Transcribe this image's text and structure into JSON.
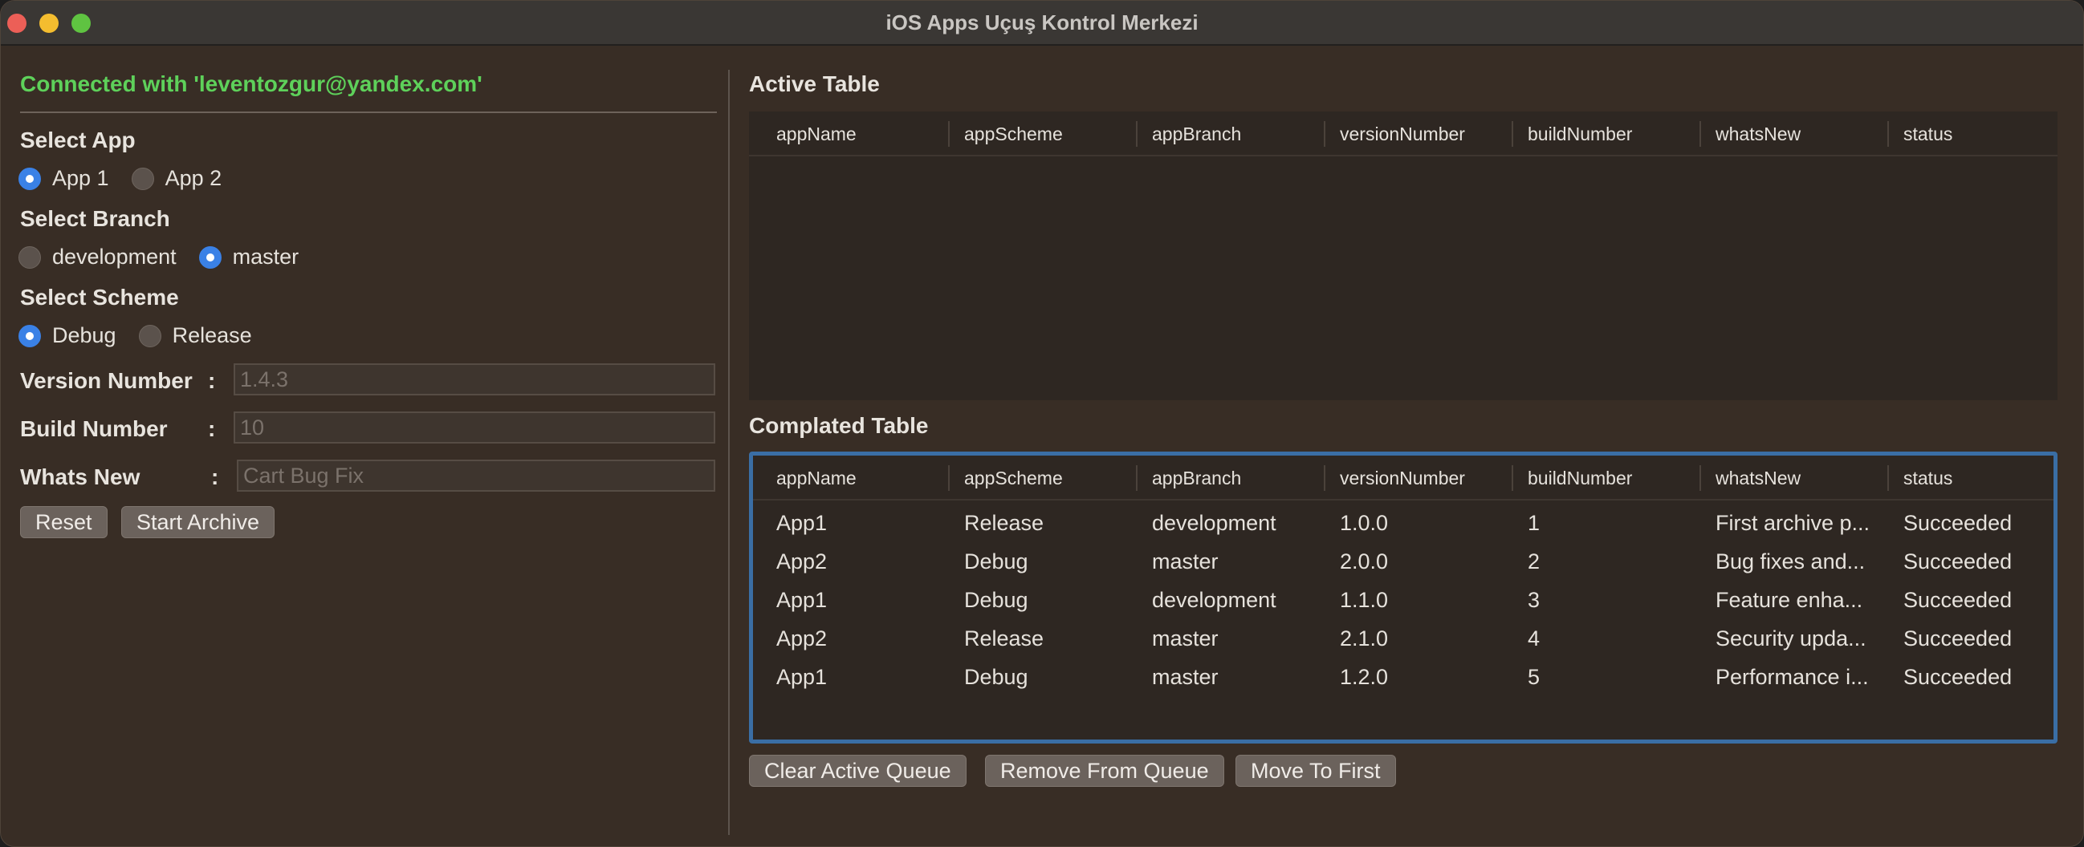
{
  "window": {
    "title": "iOS Apps Uçuş Kontrol Merkezi"
  },
  "left": {
    "connection": "Connected with 'leventozgur@yandex.com'",
    "select_app": {
      "label": "Select App",
      "options": [
        {
          "label": "App 1",
          "selected": true
        },
        {
          "label": "App 2",
          "selected": false
        }
      ]
    },
    "select_branch": {
      "label": "Select Branch",
      "options": [
        {
          "label": "development",
          "selected": false
        },
        {
          "label": "master",
          "selected": true
        }
      ]
    },
    "select_scheme": {
      "label": "Select Scheme",
      "options": [
        {
          "label": "Debug",
          "selected": true
        },
        {
          "label": "Release",
          "selected": false
        }
      ]
    },
    "fields": {
      "version": {
        "label": "Version Number",
        "colon": ":",
        "placeholder": "1.4.3"
      },
      "build": {
        "label": "Build Number",
        "colon": ":",
        "placeholder": "10"
      },
      "whats_new": {
        "label": "Whats New",
        "colon": ":",
        "placeholder": "Cart Bug Fix"
      }
    },
    "buttons": {
      "reset": "Reset",
      "start_archive": "Start Archive"
    }
  },
  "active_table": {
    "title": "Active Table",
    "columns": [
      "appName",
      "appScheme",
      "appBranch",
      "versionNumber",
      "buildNumber",
      "whatsNew",
      "status"
    ],
    "rows": []
  },
  "completed_table": {
    "title": "Complated Table",
    "columns": [
      "appName",
      "appScheme",
      "appBranch",
      "versionNumber",
      "buildNumber",
      "whatsNew",
      "status"
    ],
    "rows": [
      [
        "App1",
        "Release",
        "development",
        "1.0.0",
        "1",
        "First archive p...",
        "Succeeded"
      ],
      [
        "App2",
        "Debug",
        "master",
        "2.0.0",
        "2",
        "Bug fixes and...",
        "Succeeded"
      ],
      [
        "App1",
        "Debug",
        "development",
        "1.1.0",
        "3",
        "Feature enha...",
        "Succeeded"
      ],
      [
        "App2",
        "Release",
        "master",
        "2.1.0",
        "4",
        "Security upda...",
        "Succeeded"
      ],
      [
        "App1",
        "Debug",
        "master",
        "1.2.0",
        "5",
        "Performance i...",
        "Succeeded"
      ]
    ]
  },
  "queue_buttons": {
    "clear": "Clear Active Queue",
    "remove": "Remove From Queue",
    "move_first": "Move To First"
  }
}
